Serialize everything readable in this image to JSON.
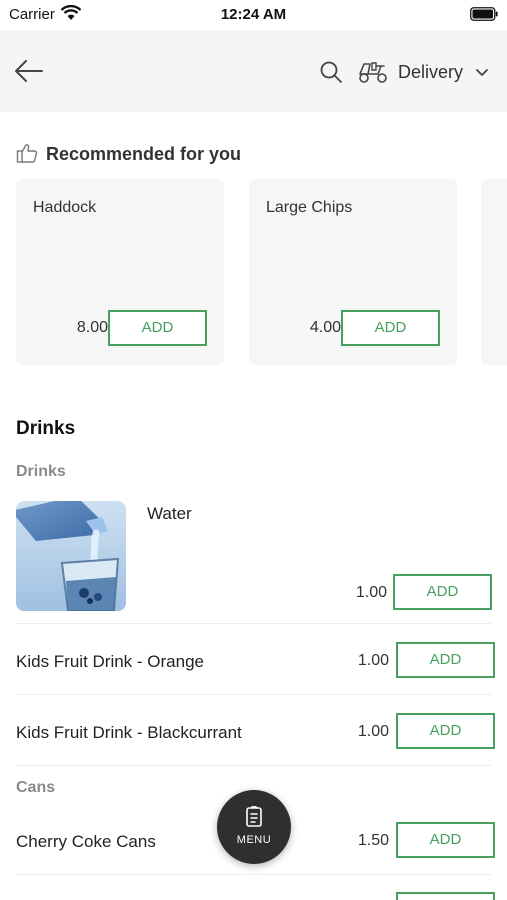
{
  "status_bar": {
    "carrier": "Carrier",
    "time": "12:24 AM"
  },
  "header": {
    "delivery_label": "Delivery"
  },
  "recommended": {
    "title": "Recommended for you",
    "items": [
      {
        "name": "Haddock",
        "price": "8.00",
        "add_label": "ADD"
      },
      {
        "name": "Large Chips",
        "price": "4.00",
        "add_label": "ADD"
      }
    ]
  },
  "menu": {
    "section_title": "Drinks",
    "groups": [
      {
        "heading": "Drinks",
        "items": [
          {
            "name": "Water",
            "price": "1.00",
            "add_label": "ADD"
          },
          {
            "name": "Kids Fruit Drink - Orange",
            "price": "1.00",
            "add_label": "ADD"
          },
          {
            "name": "Kids Fruit Drink - Blackcurrant",
            "price": "1.00",
            "add_label": "ADD"
          }
        ]
      },
      {
        "heading": "Cans",
        "items": [
          {
            "name": "Cherry Coke Cans",
            "price": "1.50",
            "add_label": "ADD"
          }
        ]
      }
    ]
  },
  "fab": {
    "label": "MENU"
  },
  "colors": {
    "accent": "#48a060",
    "header_bg": "#f5f5f5",
    "card_bg": "#f6f6f6",
    "fab_bg": "#2f2f2f"
  }
}
